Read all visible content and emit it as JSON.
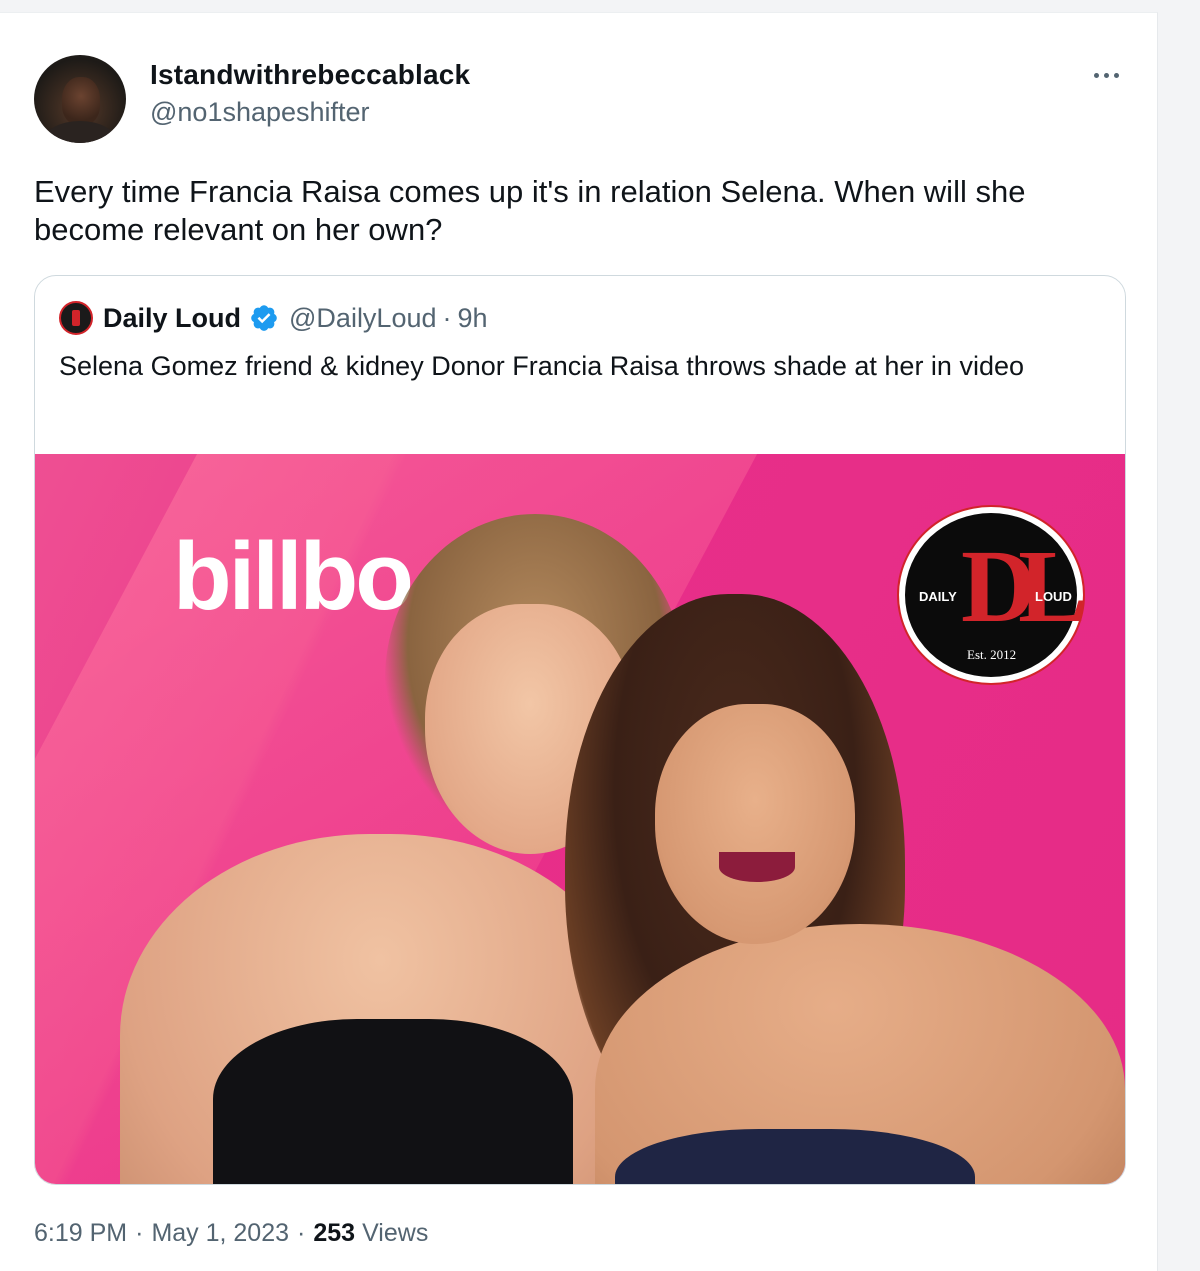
{
  "author": {
    "display_name": "Istandwithrebeccablack",
    "handle": "@no1shapeshifter"
  },
  "tweet": {
    "text": "Every time Francia Raisa comes up it's in relation Selena. When will she become relevant on her own?"
  },
  "quoted": {
    "name": "Daily Loud",
    "handle": "@DailyLoud",
    "separator": "·",
    "time": "9h",
    "text": "Selena Gomez friend & kidney Donor Francia Raisa throws shade at her in video",
    "media": {
      "backdrop_text": "billbo",
      "logo": {
        "letters": "DL",
        "left": "DAILY",
        "right": "LOUD",
        "est": "Est. 2012"
      }
    }
  },
  "footer": {
    "time": "6:19 PM",
    "sep1": "·",
    "date": "May 1, 2023",
    "sep2": "·",
    "views_count": "253",
    "views_label": "Views"
  },
  "colors": {
    "text": "#0f1419",
    "secondary": "#536471",
    "verified": "#1d9bf0",
    "pink_backdrop": "#e62b86",
    "logo_red": "#d2242a"
  },
  "icons": {
    "more": "more-horizontal-icon",
    "verified": "verified-badge-icon"
  }
}
